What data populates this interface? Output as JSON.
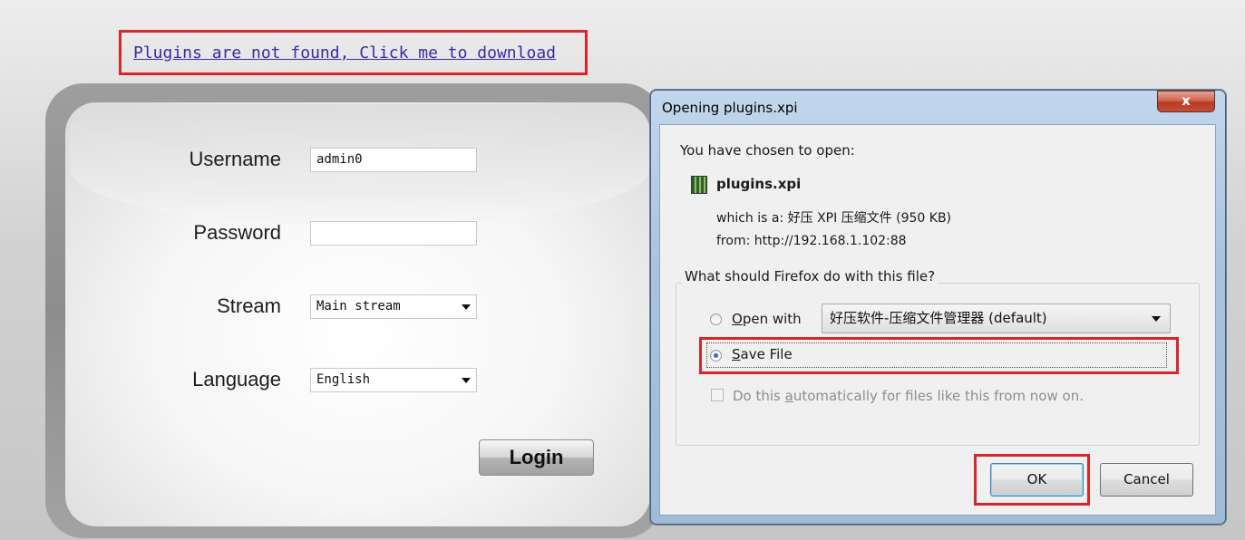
{
  "plugin_notice": {
    "text": "Plugins are not found, Click me to download"
  },
  "login": {
    "username_label": "Username",
    "username_value": "admin0",
    "password_label": "Password",
    "password_value": "",
    "stream_label": "Stream",
    "stream_value": "Main stream",
    "language_label": "Language",
    "language_value": "English",
    "login_button": "Login"
  },
  "dialog": {
    "title": "Opening plugins.xpi",
    "close_label": "x",
    "chosen_text": "You have chosen to open:",
    "file_name": "plugins.xpi",
    "which_is": "which is a:  好压 XPI 压缩文件 (950 KB)",
    "from": "from:  http://192.168.1.102:88",
    "question": "What should Firefox do with this file?",
    "open_with_label_prefix": "",
    "open_with_accel": "O",
    "open_with_rest": "pen with",
    "open_with_app": "好压软件-压缩文件管理器 (default)",
    "save_file_accel": "S",
    "save_file_rest": "ave File",
    "auto_prefix": "Do this ",
    "auto_accel": "a",
    "auto_rest": "utomatically for files like this from now on.",
    "ok_label": "OK",
    "cancel_label": "Cancel",
    "selected_option": "Save File"
  },
  "colors": {
    "highlight_red": "#d9252c",
    "link_color": "#3a2aa8",
    "dialog_frame": "#a9c3df"
  }
}
